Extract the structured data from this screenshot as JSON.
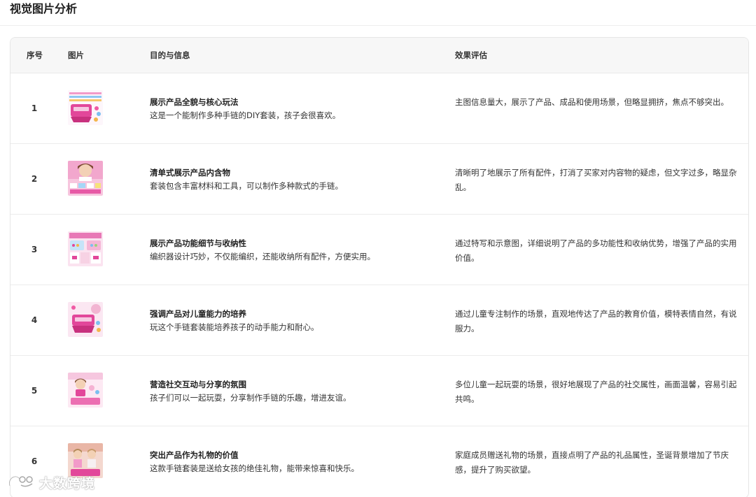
{
  "page": {
    "title": "视觉图片分析"
  },
  "table": {
    "headers": {
      "seq": "序号",
      "image": "图片",
      "purpose": "目的与信息",
      "evaluation": "效果评估"
    },
    "rows": [
      {
        "seq": "1",
        "thumb_icon": "product-kit-thumbnail",
        "purpose_title": "展示产品全貌与核心玩法",
        "purpose_desc": "这是一个能制作多种手链的DIY套装，孩子会很喜欢。",
        "evaluation": "主图信息量大，展示了产品、成品和使用场景，但略显拥挤，焦点不够突出。"
      },
      {
        "seq": "2",
        "thumb_icon": "kit-contents-thumbnail",
        "purpose_title": "清单式展示产品内含物",
        "purpose_desc": "套装包含丰富材料和工具，可以制作多种款式的手链。",
        "evaluation": "清晰明了地展示了所有配件，打消了买家对内容物的疑虑，但文字过多，略显杂乱。"
      },
      {
        "seq": "3",
        "thumb_icon": "function-detail-thumbnail",
        "purpose_title": "展示产品功能细节与收纳性",
        "purpose_desc": "编织器设计巧妙，不仅能编织，还能收纳所有配件，方便实用。",
        "evaluation": "通过特写和示意图，详细说明了产品的多功能性和收纳优势，增强了产品的实用价值。"
      },
      {
        "seq": "4",
        "thumb_icon": "child-skills-thumbnail",
        "purpose_title": "强调产品对儿童能力的培养",
        "purpose_desc": "玩这个手链套装能培养孩子的动手能力和耐心。",
        "evaluation": "通过儿童专注制作的场景，直观地传达了产品的教育价值，模特表情自然，有说服力。"
      },
      {
        "seq": "5",
        "thumb_icon": "social-play-thumbnail",
        "purpose_title": "营造社交互动与分享的氛围",
        "purpose_desc": "孩子们可以一起玩耍，分享制作手链的乐趣，增进友谊。",
        "evaluation": "多位儿童一起玩耍的场景，很好地展现了产品的社交属性，画面温馨，容易引起共鸣。"
      },
      {
        "seq": "6",
        "thumb_icon": "gift-scene-thumbnail",
        "purpose_title": "突出产品作为礼物的价值",
        "purpose_desc": "这款手链套装是送给女孩的绝佳礼物，能带来惊喜和快乐。",
        "evaluation": "家庭成员赠送礼物的场景，直接点明了产品的礼品属性，圣诞背景增加了节庆感，提升了购买欲望。"
      }
    ]
  },
  "watermark": {
    "text": "大数跨境",
    "icon": "watermark-logo-icon"
  },
  "colors": {
    "header_bg": "#f7f7f7",
    "border": "#e6e6e6",
    "thumb_pink": "#e85aa8"
  }
}
